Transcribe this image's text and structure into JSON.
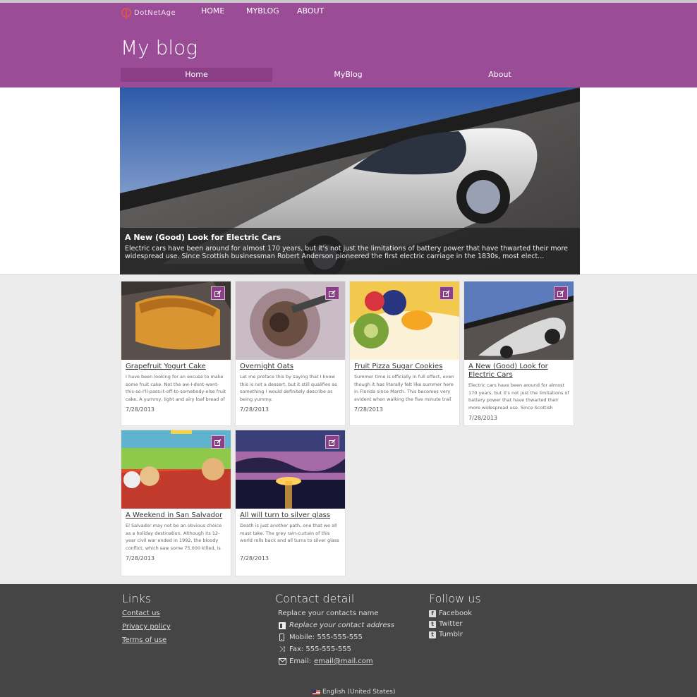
{
  "header": {
    "logo_text": "DotNetAge",
    "top_nav": [
      "HOME",
      "MYBLOG",
      "ABOUT"
    ],
    "site_title": "My blog",
    "main_nav": [
      "Home",
      "MyBlog",
      "About"
    ],
    "active_tab": "Home"
  },
  "hero": {
    "title": "A New (Good) Look for Electric Cars",
    "description": "Electric cars have been around for almost 170 years, but it's not just the limitations of battery power that have thwarted their more widespread use. Since Scottish businessman Robert Anderson pioneered the first electric carriage in the 1830s, most elect..."
  },
  "posts": [
    {
      "title": "Grapefruit Yogurt Cake",
      "excerpt": "I have been looking for an excuse to make some fruit cake. Not the aw-I-dont-want-this-so-I'll-pass-it-off-to-somebody-else fruit cake. A yummy, light and airy loaf bread of sorts. I am",
      "date": "7/28/2013",
      "image": "cake"
    },
    {
      "title": "Overnight Oats",
      "excerpt": "Let me preface this by saying that I know this is not a dessert, but it still qualifies as something I would definitely describe as being yummy.",
      "date": "7/28/2013",
      "image": "oats"
    },
    {
      "title": "Fruit Pizza Sugar Cookies",
      "excerpt": "Summer time is officially in full effect, even though it has literally felt like summer here in Florida since March. This becomes very evident when walking the five minute trail to my office",
      "date": "7/28/2013",
      "image": "cookies"
    },
    {
      "title": "A New (Good) Look for Electric Cars",
      "excerpt": "Electric cars have been around for almost 170 years, but it's not just the limitations of battery power that have thwarted their more widespread use. Since Scottish businessman",
      "date": "7/28/2013",
      "image": "car"
    },
    {
      "title": "A Weekend in San Salvador",
      "excerpt": "El Salvador may not be an obvious choice as a holiday destination. Although its 12-year civil war ended in 1992, the bloody conflict, which saw some 75,000 killed, is still something that",
      "date": "7/28/2013",
      "image": "salvador"
    },
    {
      "title": "All will turn to silver glass",
      "excerpt": "Death is just another path, one that we all must take. The grey rain-curtain of this world rolls back and all turns to silver glass",
      "date": "7/28/2013",
      "image": "sunset"
    }
  ],
  "footer": {
    "links_heading": "Links",
    "links": [
      "Contact us",
      "Privacy policy",
      "Terms of use"
    ],
    "contact_heading": "Contact detail",
    "contact_name": "Replace your contacts name",
    "contact_address": "Replace your contact address",
    "mobile": "Mobile: 555-555-555",
    "fax": "Fax: 555-555-555",
    "email_label": "Email:",
    "email": "email@mail.com",
    "follow_heading": "Follow us",
    "social": [
      "Facebook",
      "Twitter",
      "Tumblr"
    ],
    "language": "English (United States)"
  },
  "colors": {
    "brand_purple": "#9a4c96",
    "footer_bg": "#454545"
  }
}
